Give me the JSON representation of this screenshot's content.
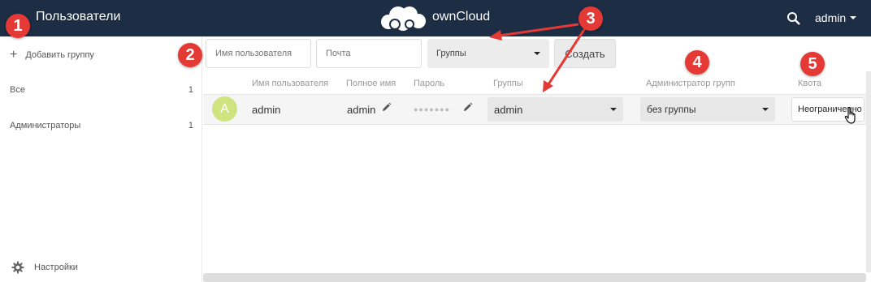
{
  "header": {
    "title": "Пользователи",
    "brand": "ownCloud",
    "user": "admin"
  },
  "sidebar": {
    "add_group": "Добавить группу",
    "groups": [
      {
        "label": "Все",
        "count": "1"
      },
      {
        "label": "Администраторы",
        "count": "1"
      }
    ],
    "settings": "Настройки"
  },
  "new_user_form": {
    "username_placeholder": "Имя пользователя",
    "email_placeholder": "Почта",
    "groups_select": "Группы",
    "create_label": "Создать"
  },
  "table": {
    "columns": [
      "Имя пользователя",
      "Полное имя",
      "Пароль",
      "Группы",
      "Администратор групп",
      "Квота"
    ],
    "rows": [
      {
        "avatar_letter": "A",
        "username": "admin",
        "full_name": "admin",
        "password": "●●●●●●●",
        "groups": "admin",
        "group_admin": "без группы",
        "quota": "Неограниченно"
      }
    ]
  },
  "annotations": [
    "1",
    "2",
    "3",
    "4",
    "5"
  ],
  "colors": {
    "header_bg": "#1d2d44",
    "badge": "#e53935",
    "avatar": "#cfe47e"
  }
}
